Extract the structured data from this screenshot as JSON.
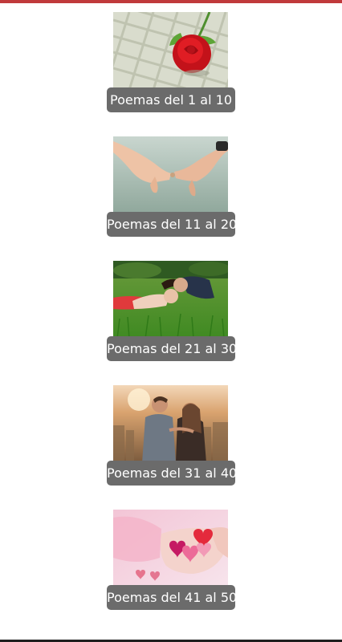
{
  "accent_color": "#c0393b",
  "sections": [
    {
      "label": "Poemas del 1 al 10",
      "image": "red-rose-on-wicker"
    },
    {
      "label": "Poemas del 11 al 20",
      "image": "holding-pinky-fingers"
    },
    {
      "label": "Poemas del 21 al 30",
      "image": "couple-lying-on-grass"
    },
    {
      "label": "Poemas del 31 al 40",
      "image": "couple-overlooking-city"
    },
    {
      "label": "Poemas del 41 al 50",
      "image": "hands-holding-hearts"
    }
  ]
}
